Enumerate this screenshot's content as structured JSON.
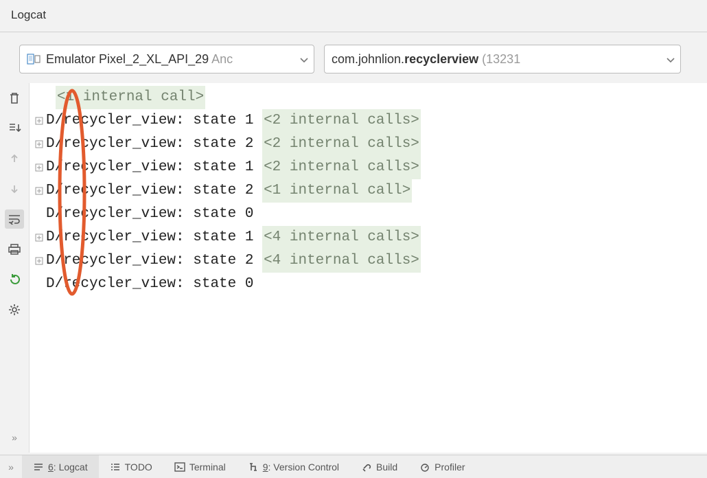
{
  "panel_title": "Logcat",
  "device_selector": {
    "icon": "device-icon",
    "name": "Emulator Pixel_2_XL_API_29",
    "suffix": " Anc"
  },
  "process_selector": {
    "prefix": "com.johnlion.",
    "bold": "recyclerview",
    "suffix": " (13231"
  },
  "log_lines": [
    {
      "expandable": false,
      "first_internal": true,
      "text": "",
      "badge": "<1 internal call>"
    },
    {
      "expandable": true,
      "text": "D/recycler_view: state 1 ",
      "badge": "<2 internal calls>"
    },
    {
      "expandable": true,
      "text": "D/recycler_view: state 2 ",
      "badge": "<2 internal calls>"
    },
    {
      "expandable": true,
      "text": "D/recycler_view: state 1 ",
      "badge": "<2 internal calls>"
    },
    {
      "expandable": true,
      "text": "D/recycler_view: state 2 ",
      "badge": "<1 internal call>"
    },
    {
      "expandable": false,
      "text": "D/recycler_view: state 0",
      "badge": ""
    },
    {
      "expandable": true,
      "text": "D/recycler_view: state 1 ",
      "badge": "<4 internal calls>"
    },
    {
      "expandable": true,
      "text": "D/recycler_view: state 2 ",
      "badge": "<4 internal calls>"
    },
    {
      "expandable": false,
      "text": "D/recycler_view: state 0",
      "badge": ""
    }
  ],
  "bottom_tabs": {
    "logcat": {
      "num": "6",
      "label": ": Logcat"
    },
    "todo": "TODO",
    "terminal": "Terminal",
    "vcs": {
      "num": "9",
      "label": ": Version Control"
    },
    "build": "Build",
    "profiler": "Profiler"
  }
}
